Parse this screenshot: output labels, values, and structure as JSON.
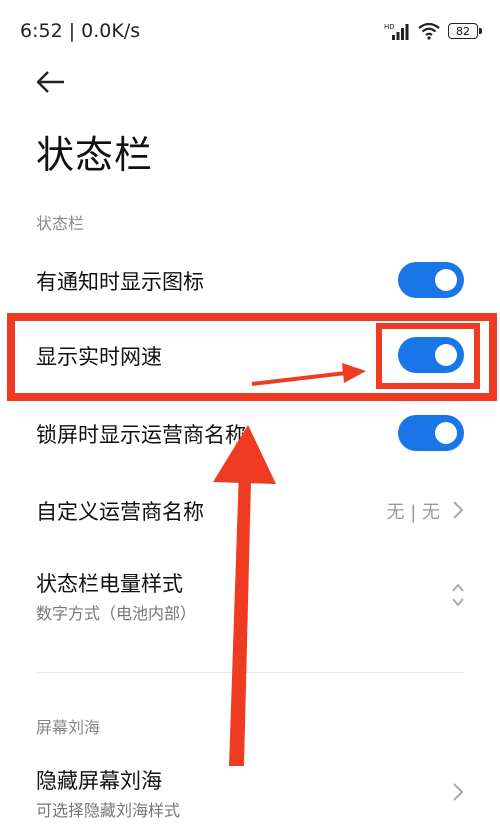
{
  "status_bar": {
    "time_speed": "6:52 | 0.0K/s",
    "battery_level": "82",
    "signal_tag": "HD"
  },
  "header": {
    "back_icon": "arrow-left-icon",
    "title": "状态栏"
  },
  "section_status_bar": {
    "header": "状态栏",
    "rows": [
      {
        "label": "有通知时显示图标",
        "toggle_on": true
      },
      {
        "label": "显示实时网速",
        "toggle_on": true
      },
      {
        "label": "锁屏时显示运营商名称",
        "toggle_on": true
      },
      {
        "label": "自定义运营商名称",
        "value": "无 | 无"
      },
      {
        "label": "状态栏电量样式",
        "sublabel": "数字方式（电池内部）"
      }
    ]
  },
  "section_notch": {
    "header": "屏幕刘海",
    "rows": [
      {
        "label": "隐藏屏幕刘海",
        "sublabel": "可选择隐藏刘海样式"
      }
    ]
  },
  "colors": {
    "toggle_on": "#1976e8",
    "annotation_red": "#ee3b22"
  }
}
